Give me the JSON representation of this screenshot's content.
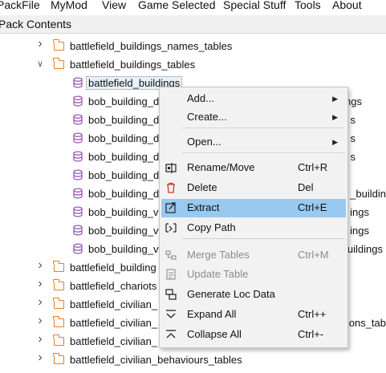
{
  "menubar": {
    "items": [
      "PackFile",
      "MyMod",
      "View",
      "Game Selected",
      "Special Stuff",
      "Tools",
      "About"
    ]
  },
  "pane": {
    "title": "Pack Contents"
  },
  "colors": {
    "folder": "#e87e22",
    "db_table": "#9b59b6",
    "highlight": "#99c9ef"
  },
  "tree": {
    "rows": [
      {
        "label": "battlefield_buildings_names_tables",
        "icon": "folder-icon",
        "expander": "collapsed"
      },
      {
        "label": "battlefield_buildings_tables",
        "icon": "folder-icon",
        "expander": "expanded"
      },
      {
        "label": "battlefield_buildings",
        "icon": "db-table-icon",
        "selected": true
      },
      {
        "label": "bob_building_d",
        "tail": "ngs",
        "icon": "db-table-icon"
      },
      {
        "label": "bob_building_d",
        "tail": "s",
        "icon": "db-table-icon"
      },
      {
        "label": "bob_building_d",
        "tail": "s",
        "icon": "db-table-icon"
      },
      {
        "label": "bob_building_d",
        "tail": "s",
        "icon": "db-table-icon"
      },
      {
        "label": "bob_building_d",
        "tail": "",
        "icon": "db-table-icon"
      },
      {
        "label": "bob_building_d",
        "tail": "_buildin",
        "icon": "db-table-icon"
      },
      {
        "label": "bob_building_v",
        "tail": "ings",
        "icon": "db-table-icon"
      },
      {
        "label": "bob_building_v",
        "tail": "ings",
        "icon": "db-table-icon"
      },
      {
        "label": "bob_building_v",
        "tail": "buildings",
        "icon": "db-table-icon"
      },
      {
        "label": "battlefield_building",
        "icon": "folder-icon",
        "expander": "collapsed"
      },
      {
        "label": "battlefield_chariots",
        "icon": "folder-icon",
        "expander": "collapsed"
      },
      {
        "label": "battlefield_civilian_",
        "icon": "folder-icon",
        "expander": "collapsed"
      },
      {
        "label": "battlefield_civilian_",
        "tail": "ons_tab",
        "icon": "folder-icon",
        "expander": "collapsed"
      },
      {
        "label": "battlefield_civilian_",
        "icon": "folder-icon",
        "expander": "collapsed"
      },
      {
        "label": "battlefield_civilian_behaviours_tables",
        "icon": "folder-icon",
        "expander": "collapsed"
      }
    ]
  },
  "context_menu": {
    "items": [
      {
        "label": "Add...",
        "submenu": true,
        "icon": ""
      },
      {
        "label": "Create...",
        "submenu": true,
        "icon": ""
      },
      {
        "separator": true
      },
      {
        "label": "Open...",
        "submenu": true,
        "icon": ""
      },
      {
        "separator": true
      },
      {
        "label": "Rename/Move",
        "shortcut": "Ctrl+R",
        "icon": "rename-icon"
      },
      {
        "label": "Delete",
        "shortcut": "Del",
        "icon": "trash-icon"
      },
      {
        "label": "Extract",
        "shortcut": "Ctrl+E",
        "icon": "extract-icon",
        "highlighted": true
      },
      {
        "label": "Copy Path",
        "icon": "copy-path-icon"
      },
      {
        "separator": true
      },
      {
        "label": "Merge Tables",
        "shortcut": "Ctrl+M",
        "icon": "merge-icon",
        "disabled": true
      },
      {
        "label": "Update Table",
        "icon": "update-icon",
        "disabled": true
      },
      {
        "label": "Generate Loc Data",
        "icon": "generate-loc-icon"
      },
      {
        "label": "Expand All",
        "shortcut": "Ctrl++",
        "icon": "expand-all-icon"
      },
      {
        "label": "Collapse All",
        "shortcut": "Ctrl+-",
        "icon": "collapse-all-icon"
      }
    ]
  }
}
